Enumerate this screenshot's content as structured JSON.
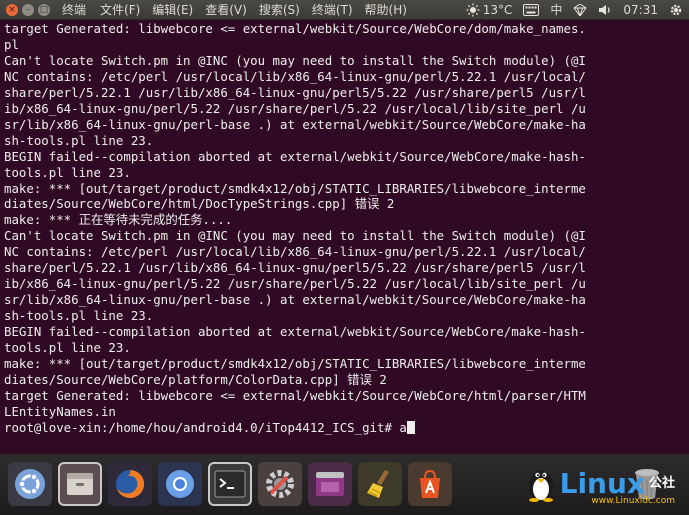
{
  "topbar": {
    "window_buttons": [
      "×",
      "–",
      "□"
    ],
    "app_name": "终端",
    "menu": [
      "文件(F)",
      "编辑(E)",
      "查看(V)",
      "搜索(S)",
      "终端(T)",
      "帮助(H)"
    ],
    "indicators": {
      "temperature": "13°C",
      "input_method": "中",
      "time": "07:31"
    }
  },
  "terminal": {
    "lines": [
      "target Generated: libwebcore <= external/webkit/Source/WebCore/dom/make_names.",
      "pl",
      "Can't locate Switch.pm in @INC (you may need to install the Switch module) (@I",
      "NC contains: /etc/perl /usr/local/lib/x86_64-linux-gnu/perl/5.22.1 /usr/local/",
      "share/perl/5.22.1 /usr/lib/x86_64-linux-gnu/perl5/5.22 /usr/share/perl5 /usr/l",
      "ib/x86_64-linux-gnu/perl/5.22 /usr/share/perl/5.22 /usr/local/lib/site_perl /u",
      "sr/lib/x86_64-linux-gnu/perl-base .) at external/webkit/Source/WebCore/make-ha",
      "sh-tools.pl line 23.",
      "BEGIN failed--compilation aborted at external/webkit/Source/WebCore/make-hash-",
      "tools.pl line 23.",
      "make: *** [out/target/product/smdk4x12/obj/STATIC_LIBRARIES/libwebcore_interme",
      "diates/Source/WebCore/html/DocTypeStrings.cpp] 错误 2",
      "make: *** 正在等待未完成的任务....",
      "Can't locate Switch.pm in @INC (you may need to install the Switch module) (@I",
      "NC contains: /etc/perl /usr/local/lib/x86_64-linux-gnu/perl/5.22.1 /usr/local/",
      "share/perl/5.22.1 /usr/lib/x86_64-linux-gnu/perl5/5.22 /usr/share/perl5 /usr/l",
      "ib/x86_64-linux-gnu/perl/5.22 /usr/share/perl/5.22 /usr/local/lib/site_perl /u",
      "sr/lib/x86_64-linux-gnu/perl-base .) at external/webkit/Source/WebCore/make-ha",
      "sh-tools.pl line 23.",
      "BEGIN failed--compilation aborted at external/webkit/Source/WebCore/make-hash-",
      "tools.pl line 23.",
      "make: *** [out/target/product/smdk4x12/obj/STATIC_LIBRARIES/libwebcore_interme",
      "diates/Source/WebCore/platform/ColorData.cpp] 错误 2",
      "target Generated: libwebcore <= external/webkit/Source/WebCore/html/parser/HTM",
      "LEntityNames.in"
    ],
    "prompt": "root@love-xin:/home/hou/android4.0/iTop4412_ICS_git# ",
    "input": "a"
  },
  "dock": {
    "items": [
      "ubuntu-icon",
      "file-manager-icon",
      "firefox-icon",
      "chromium-icon",
      "terminal-icon",
      "system-settings-icon",
      "ubuntu-software-icon",
      "bleachbit-icon",
      "software-center-icon",
      "trash-icon"
    ]
  },
  "watermark": {
    "brand": "Linux",
    "brand_cn": "公社",
    "url": "www.Linuxidc.com"
  },
  "colors": {
    "terminal_bg": "#300a24",
    "terminal_fg": "#eeeeec",
    "topbar_bg": "#3c3b37",
    "ubuntu_orange": "#e95420"
  }
}
